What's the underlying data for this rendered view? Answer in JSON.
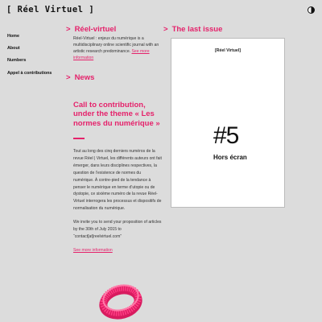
{
  "brand": {
    "logo": "[ Réel Virtuel ]"
  },
  "nav": {
    "items": [
      "Home",
      "About",
      "Numbers",
      "Appel à contributions"
    ]
  },
  "about": {
    "title": "Réel-virtuel",
    "text": "Réel-Virtuel : enjeux du numérique is a multidisciplinary online scientific journal with an artistic research predominance.",
    "link": "See more information"
  },
  "last_issue": {
    "title": "The last issue",
    "brand": "[Réel Virtuel]",
    "number": "#5",
    "name": "Hors écran"
  },
  "news": {
    "title": "News",
    "headline": "Call to contribution, under the theme « Les normes du numérique »",
    "paragraphs": [
      "Tout au long des cinq derniers numéros de la revue Réel | Virtuel, les différents auteurs ont fait émerger, dans leurs disciplines respectives, la question de l’existence de normes du numérique. À contre-pied de la tendance à penser le numérique en terme d’utopie ou de dystopie, ce sixième numéro de la revue Réel-Virtuel interrogera les processus et dispositifs de normalisation du numérique.",
      "We invite you to send your proposition of articles by the 30th of July 2015 to “contact[at]reelvirtuel.com”"
    ],
    "link": "See more information"
  },
  "colors": {
    "accent": "#e5226b",
    "background": "#dcdcdc"
  },
  "icons": {
    "toggle": "contrast-toggle-icon",
    "arrow": ">",
    "decoration": "pink-ring-icon"
  }
}
